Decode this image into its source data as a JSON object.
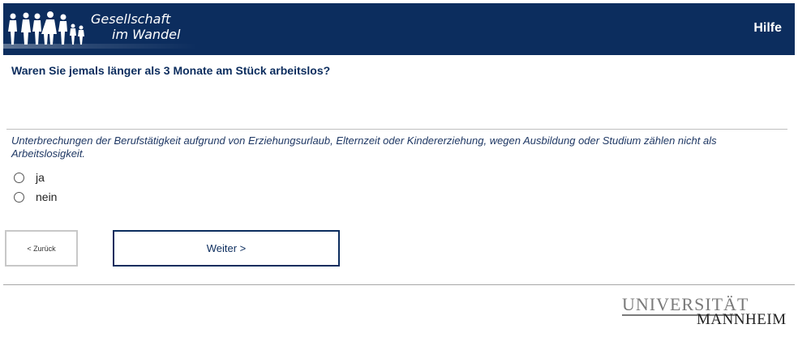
{
  "header": {
    "brand_line1": "Gesellschaft",
    "brand_line2": "im Wandel",
    "help_label": "Hilfe",
    "logo_icon": "people-silhouettes-icon",
    "colors": {
      "background": "#0c2d5e",
      "text": "#ffffff"
    }
  },
  "question": {
    "text": "Waren Sie jemals länger als 3 Monate am Stück arbeitslos?",
    "hint": "Unterbrechungen der Berufstätigkeit aufgrund von Erziehungsurlaub, Elternzeit oder Kindererziehung, wegen Ausbildung oder Studium zählen nicht als Arbeitslosigkeit.",
    "options": [
      {
        "label": "ja",
        "selected": false
      },
      {
        "label": "nein",
        "selected": false
      }
    ]
  },
  "navigation": {
    "back_label": "< Zurück",
    "next_label": "Weiter >"
  },
  "footer": {
    "university_line1": "UNIVERSITÄT",
    "university_line2": "MANNHEIM"
  }
}
